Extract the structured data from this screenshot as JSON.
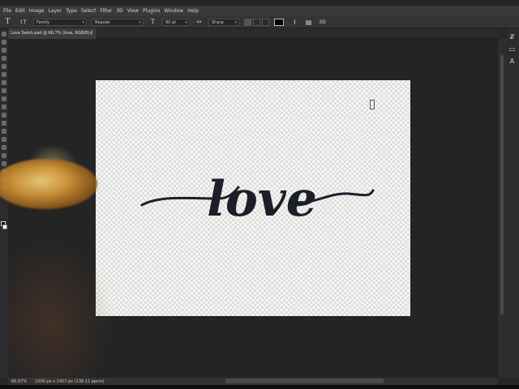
{
  "menubar": {
    "items": [
      "File",
      "Edit",
      "Image",
      "Layer",
      "Type",
      "Select",
      "Filter",
      "3D",
      "View",
      "Plugins",
      "Window",
      "Help"
    ]
  },
  "options": {
    "font_family": "Family",
    "font_style": "Regular",
    "font_size": "90 pt",
    "antialias": "Sharp",
    "text_color": "#000000"
  },
  "tab": {
    "title": "Love Swish.psd @ 66.7% (love, RGB/8) *",
    "close": "×"
  },
  "canvas": {
    "artwork_text": "love",
    "text_color": "#1c1e2a"
  },
  "status": {
    "zoom": "66.67%",
    "doc_info": "1000 px x 1457 px (138.11 ppcm)"
  },
  "icons": {
    "type_tool": "T",
    "orientation": "↕T",
    "size": "T",
    "antialias": "aa",
    "warp": "warp-text-icon",
    "panels": "character-panel-icon",
    "3d": "3D"
  }
}
